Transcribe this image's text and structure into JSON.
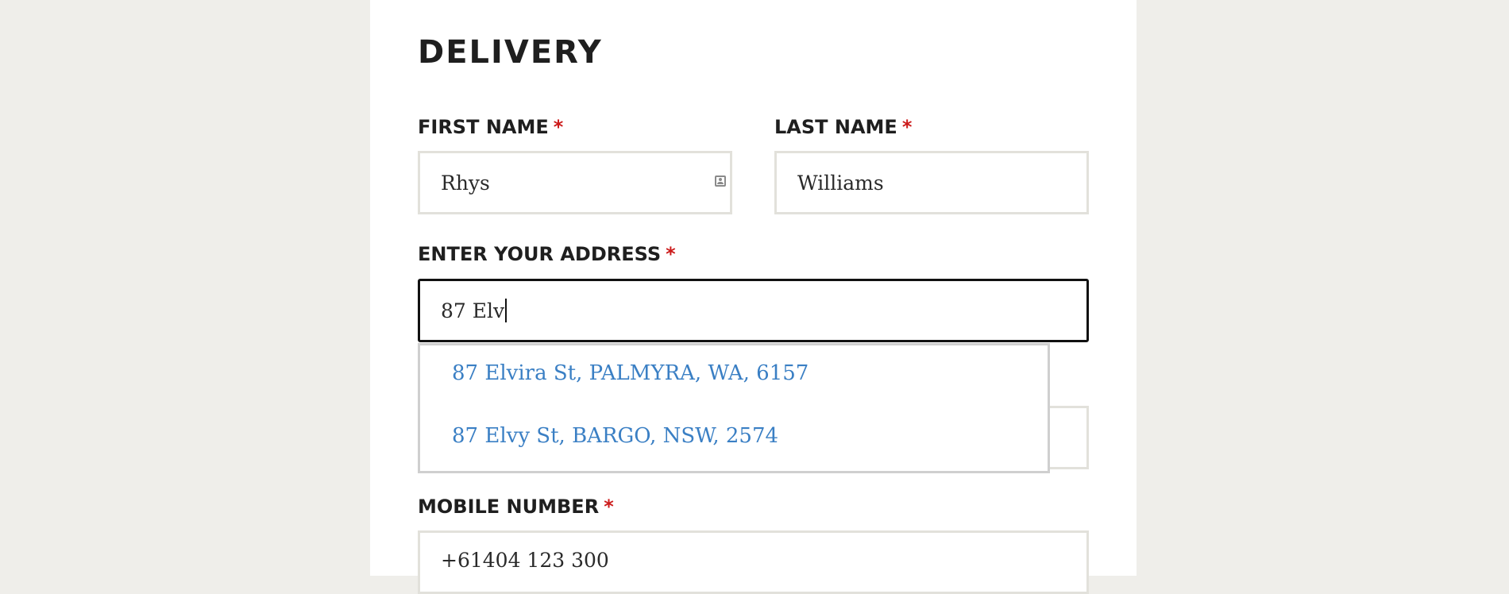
{
  "form": {
    "heading": "DELIVERY",
    "required_marker": "*",
    "first_name": {
      "label": "FIRST NAME",
      "value": "Rhys"
    },
    "last_name": {
      "label": "LAST NAME",
      "value": "Williams"
    },
    "address": {
      "label": "ENTER YOUR ADDRESS",
      "value": "87 Elv",
      "suggestions": [
        "87 Elvira St, PALMYRA, WA, 6157",
        "87 Elvy St, BARGO, NSW, 2574"
      ]
    },
    "mobile": {
      "label": "MOBILE NUMBER",
      "value": "+61404 123 300"
    }
  },
  "colors": {
    "background": "#efeeea",
    "panel": "#ffffff",
    "required": "#cc1b1b",
    "suggestion_link": "#3a7fc4",
    "field_border": "#e2e1db",
    "focused_border": "#111111"
  },
  "icons": {
    "first_name_autofill": "contact-card-icon"
  }
}
